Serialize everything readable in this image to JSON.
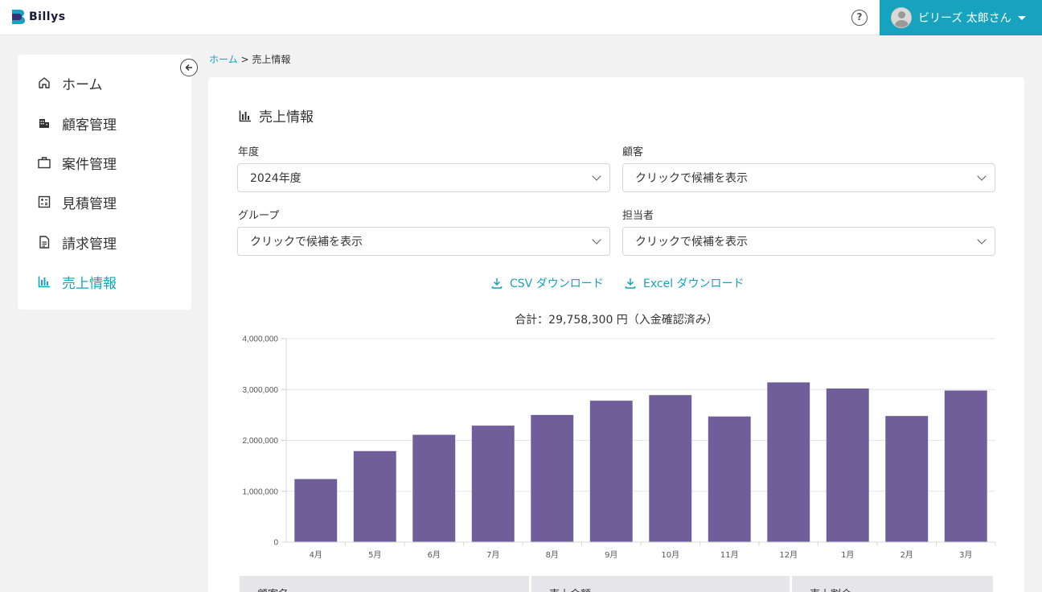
{
  "app": {
    "logo_text": "Billys"
  },
  "header": {
    "user_name": "ビリーズ 太郎さん"
  },
  "sidebar": {
    "items": [
      {
        "label": "ホーム",
        "icon": "home-icon"
      },
      {
        "label": "顧客管理",
        "icon": "building-icon"
      },
      {
        "label": "案件管理",
        "icon": "briefcase-icon"
      },
      {
        "label": "見積管理",
        "icon": "calculator-icon"
      },
      {
        "label": "請求管理",
        "icon": "document-icon"
      },
      {
        "label": "売上情報",
        "icon": "bar-chart-icon",
        "active": true
      }
    ]
  },
  "breadcrumb": {
    "home": "ホーム",
    "separator": ">",
    "current": "売上情報"
  },
  "page": {
    "title": "売上情報"
  },
  "filters": {
    "year": {
      "label": "年度",
      "value": "2024年度"
    },
    "customer": {
      "label": "顧客",
      "value": "クリックで候補を表示"
    },
    "group": {
      "label": "グループ",
      "value": "クリックで候補を表示"
    },
    "assignee": {
      "label": "担当者",
      "value": "クリックで候補を表示"
    }
  },
  "downloads": {
    "csv": "CSV ダウンロード",
    "excel": "Excel ダウンロード"
  },
  "summary": {
    "total": "合計：29,758,300 円（入金確認済み）"
  },
  "colors": {
    "accent": "#17a2be",
    "bar": "#6f5e9a"
  },
  "chart_data": {
    "type": "bar",
    "categories": [
      "4月",
      "5月",
      "6月",
      "7月",
      "8月",
      "9月",
      "10月",
      "11月",
      "12月",
      "1月",
      "2月",
      "3月"
    ],
    "values": [
      1240000,
      1790000,
      2110000,
      2290000,
      2500000,
      2780000,
      2890000,
      2470000,
      3140000,
      3020000,
      2480000,
      2980000
    ],
    "ylim": [
      0,
      4000000
    ],
    "yticks": [
      "0",
      "1,000,000",
      "2,000,000",
      "3,000,000",
      "4,000,000"
    ],
    "ytick_values": [
      0,
      1000000,
      2000000,
      3000000,
      4000000
    ],
    "grid": true
  },
  "table": {
    "headers": [
      "顧客名",
      "売上金額",
      "売上割合"
    ]
  }
}
